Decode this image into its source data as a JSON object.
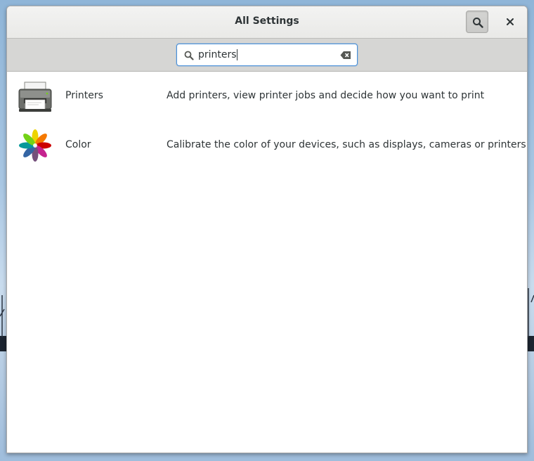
{
  "window": {
    "title": "All Settings"
  },
  "header": {
    "search_toggle_icon": "search-icon",
    "close_icon": "close-icon"
  },
  "search": {
    "value": "printers",
    "icon": "search-icon",
    "clear_icon": "clear-text-icon"
  },
  "results": [
    {
      "name": "Printers",
      "description": "Add printers, view printer jobs and decide how you want to print",
      "icon": "printer-icon"
    },
    {
      "name": "Color",
      "description": "Calibrate the color of your devices, such as displays, cameras or printers",
      "icon": "color-icon"
    }
  ],
  "colors": {
    "accent": "#4a90d9",
    "text": "#2e3436",
    "headerbar": "#ebebea",
    "searchbar": "#d6d6d4"
  }
}
